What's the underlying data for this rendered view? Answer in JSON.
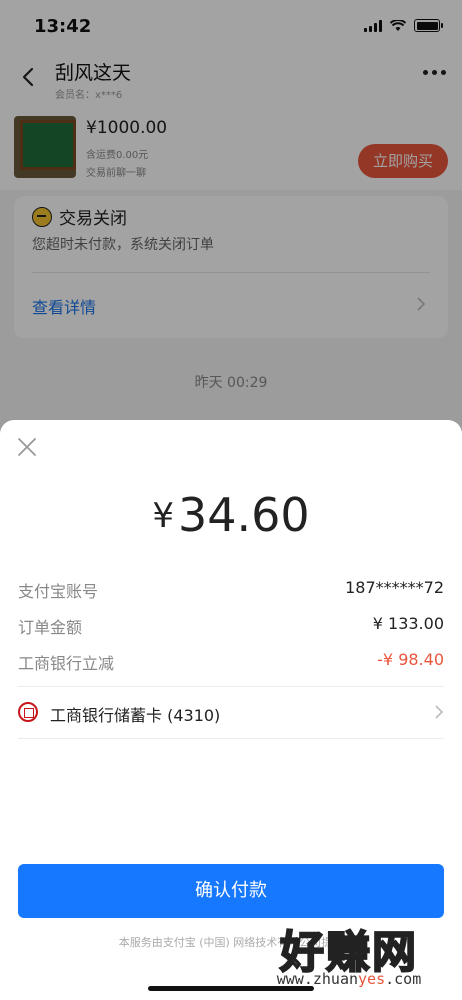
{
  "status_bar": {
    "time": "13:42"
  },
  "nav": {
    "title": "刮风这天",
    "subtitle": "会员名：x***6"
  },
  "product": {
    "price": "¥1000.00",
    "shipping": "含运费0.00元",
    "chat": "交易前聊一聊",
    "buy_label": "立即购买"
  },
  "order_status": {
    "title": "交易关闭",
    "description": "您超时未付款，系统关闭订单",
    "details_link": "查看详情"
  },
  "chat_timestamp": "昨天 00:29",
  "payment": {
    "currency": "¥",
    "amount": "34.60",
    "rows": [
      {
        "label": "支付宝账号",
        "value": "187******72"
      },
      {
        "label": "订单金额",
        "value": "¥ 133.00"
      },
      {
        "label": "工商银行立减",
        "value": "-¥ 98.40"
      }
    ],
    "method": "工商银行储蓄卡 (4310)",
    "confirm_label": "确认付款",
    "footer": "本服务由支付宝 (中国) 网络技术有限公司提供"
  },
  "watermark": {
    "big": "好赚网",
    "small_prefix": "www.zhuan",
    "small_accent": "yes",
    "small_suffix": ".com"
  },
  "colors": {
    "accent_blue": "#1677ff",
    "buy_orange": "#e8563d",
    "link_blue": "#1a73e8",
    "discount_red": "#e8563d"
  },
  "icons": [
    "back-icon",
    "more-icon",
    "minus-circle-icon",
    "chevron-right-icon",
    "close-icon",
    "icbc-icon",
    "signal-icon",
    "wifi-icon",
    "battery-icon"
  ]
}
